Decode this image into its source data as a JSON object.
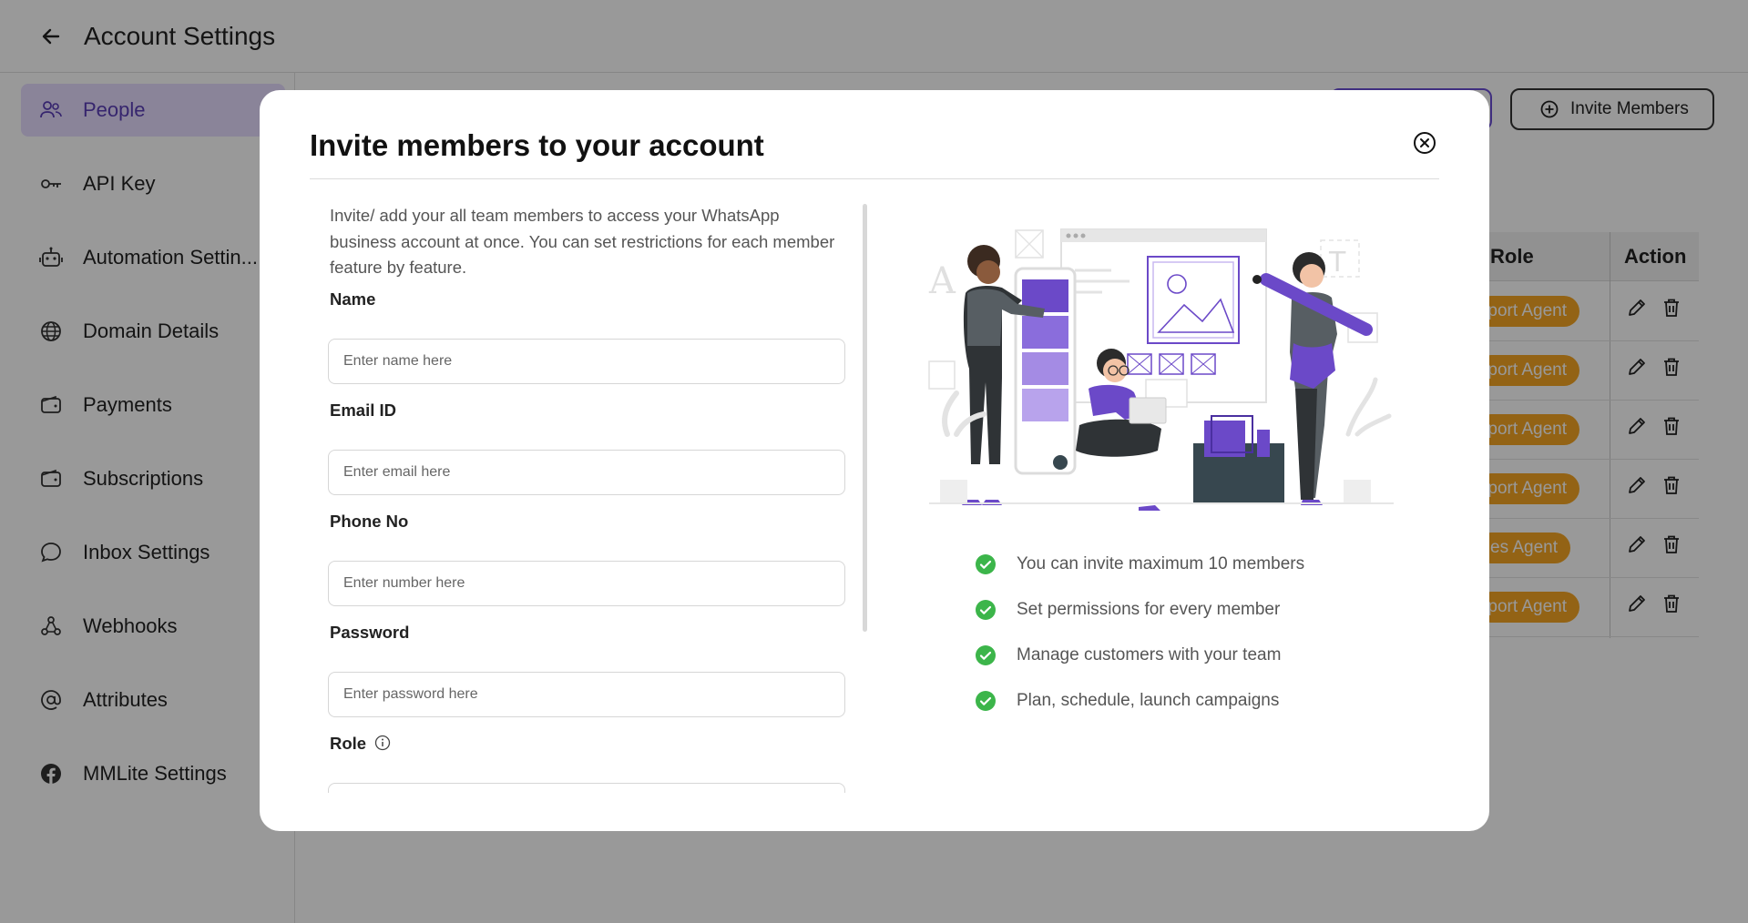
{
  "header": {
    "title": "Account Settings"
  },
  "sidebar": {
    "items": [
      {
        "label": "People",
        "icon": "people-icon",
        "active": true
      },
      {
        "label": "API Key",
        "icon": "key-icon"
      },
      {
        "label": "Automation Settin...",
        "icon": "bot-icon"
      },
      {
        "label": "Domain Details",
        "icon": "globe-icon"
      },
      {
        "label": "Payments",
        "icon": "wallet-icon"
      },
      {
        "label": "Subscriptions",
        "icon": "wallet-icon"
      },
      {
        "label": "Inbox Settings",
        "icon": "chat-bubble-icon"
      },
      {
        "label": "Webhooks",
        "icon": "webhook-icon"
      },
      {
        "label": "Attributes",
        "icon": "at-sign-icon"
      },
      {
        "label": "MMLite Settings",
        "icon": "facebook-icon"
      }
    ]
  },
  "toolbar": {
    "invite_label": "Invite Members"
  },
  "table": {
    "headers": {
      "role": "Role",
      "action": "Action"
    },
    "rows": [
      {
        "role": "port Agent"
      },
      {
        "role": "port Agent"
      },
      {
        "role": "port Agent"
      },
      {
        "role": "port Agent"
      },
      {
        "role": "es Agent"
      },
      {
        "role": "port Agent"
      }
    ]
  },
  "modal": {
    "title": "Invite members to your account",
    "intro": "Invite/ add your all team members to access your WhatsApp business account at once. You can set restrictions for each member feature by feature.",
    "fields": [
      {
        "label": "Name",
        "placeholder": "Enter name here"
      },
      {
        "label": "Email ID",
        "placeholder": "Enter email here"
      },
      {
        "label": "Phone No",
        "placeholder": "Enter number here"
      },
      {
        "label": "Password",
        "placeholder": "Enter password here"
      }
    ],
    "role_label": "Role",
    "features": [
      "You can invite maximum 10 members",
      "Set permissions for every member",
      "Manage customers with your team",
      "Plan, schedule, launch campaigns"
    ]
  },
  "colors": {
    "accent": "#6c4fd6",
    "active_bg": "#e6dcff",
    "role_pill": "#f5a623",
    "check_green": "#3cb54a",
    "overlay": "rgba(0,0,0,0.40)"
  }
}
